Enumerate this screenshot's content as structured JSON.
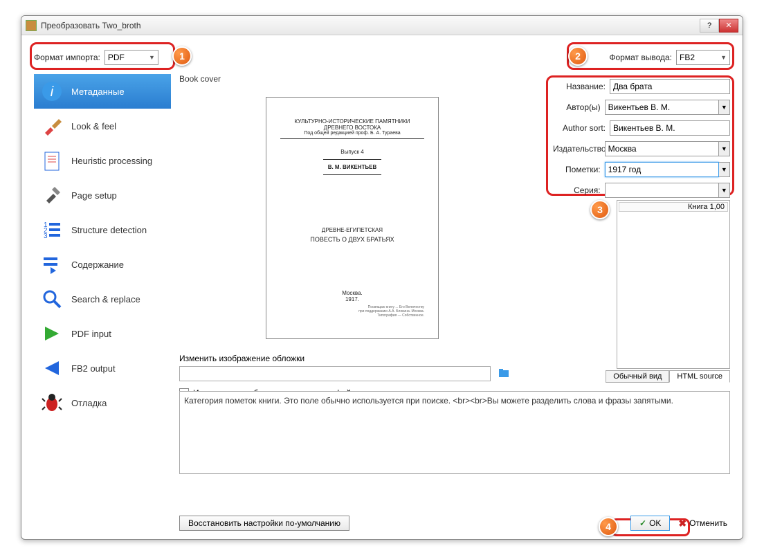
{
  "window": {
    "title": "Преобразовать Two_broth"
  },
  "import": {
    "label": "Формат импорта:",
    "value": "PDF"
  },
  "output": {
    "label": "Формат вывода:",
    "value": "FB2"
  },
  "sidebar": {
    "items": [
      {
        "label": "Метаданные"
      },
      {
        "label": "Look & feel"
      },
      {
        "label": "Heuristic processing"
      },
      {
        "label": "Page setup"
      },
      {
        "label": "Structure detection"
      },
      {
        "label": "Содержание"
      },
      {
        "label": "Search & replace"
      },
      {
        "label": "PDF input"
      },
      {
        "label": "FB2 output"
      },
      {
        "label": "Отладка"
      }
    ]
  },
  "cover": {
    "label": "Book cover",
    "line1": "КУЛЬТУРНО-ИСТОРИЧЕСКИЕ ПАМЯТНИКИ",
    "line2": "ДРЕВНЕГО ВОСТОКА",
    "line3": "Под общей редакцией проф. Б. А. Тураева",
    "issue": "Выпуск 4",
    "author": "В. М. ВИКЕНТЬЕВ",
    "mid1": "ДРЕВНЕ-ЕГИПЕТСКАЯ",
    "mid2": "ПОВЕСТЬ О ДВУХ БРАТЬЯХ",
    "city": "Москва.",
    "year": "1917.",
    "change_label": "Изменить изображение обложки",
    "use_source": "Использовать обложку из исходного файла"
  },
  "meta": {
    "title_lbl": "Название:",
    "title_val": "Два брата",
    "author_lbl": "Автор(ы)",
    "author_val": "Викентьев В. М.",
    "sort_lbl": "Author sort:",
    "sort_val": "Викентьев В. М.",
    "pub_lbl": "Издательство:",
    "pub_val": "Москва",
    "tags_lbl": "Пометки:",
    "tags_val": "1917 год",
    "series_lbl": "Серия:",
    "series_val": "",
    "series_item": "Книга 1,00"
  },
  "tabs": {
    "normal": "Обычный вид",
    "html": "HTML source"
  },
  "help": "Категория пометок книги.  Это поле обычно используется при поиске. <br><br>Вы можете разделить слова и фразы запятыми.",
  "buttons": {
    "restore": "Восстановить настройки по-умолчанию",
    "ok": "OK",
    "cancel": "Отменить"
  },
  "badges": {
    "b1": "1",
    "b2": "2",
    "b3": "3",
    "b4": "4"
  }
}
